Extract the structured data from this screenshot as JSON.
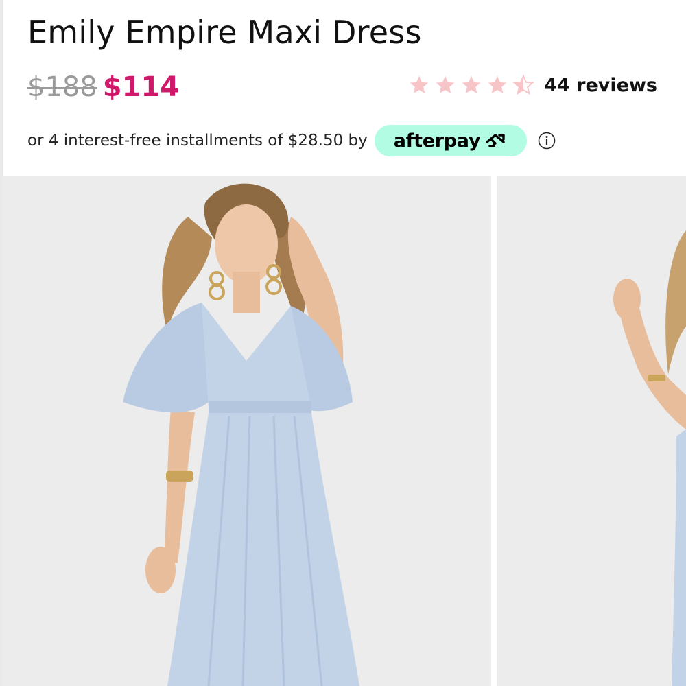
{
  "product": {
    "title": "Emily Empire Maxi Dress",
    "price_original": "$188",
    "price_sale": "$114",
    "sale_color": "#d0186a"
  },
  "rating": {
    "value": 4.5,
    "max": 5,
    "star_color": "#f7c5c8",
    "reviews_label": "44 reviews"
  },
  "installments": {
    "text": "or 4 interest-free installments of $28.50 by",
    "provider_label": "afterpay",
    "provider_icon": "afterpay-arrows-icon",
    "badge_color": "#b2fce4",
    "info_icon": "info-circle-icon"
  },
  "gallery": {
    "images": [
      {
        "name": "model-front-view",
        "dress_color": "#c2d3e8"
      },
      {
        "name": "model-side-view",
        "dress_color": "#c2d3e8"
      }
    ]
  }
}
